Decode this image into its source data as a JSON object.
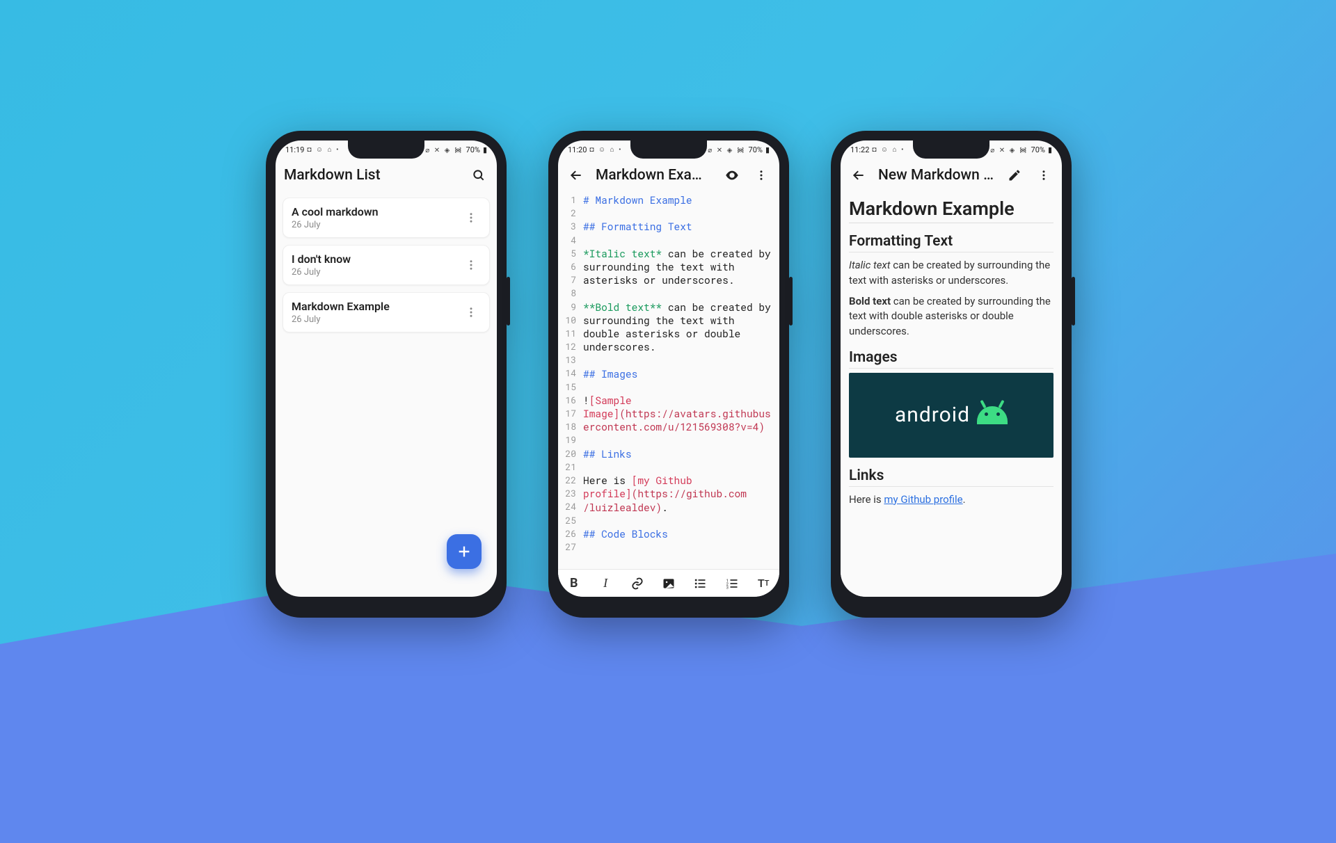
{
  "phone1": {
    "status": {
      "time": "11:19",
      "left_icons": "◘ ☺ ⌂ •",
      "right_icons": "⌀ ✕ ◈ ᯼",
      "battery": "70%"
    },
    "appbar": {
      "title": "Markdown List"
    },
    "notes": [
      {
        "name": "A cool markdown",
        "date": "26 July"
      },
      {
        "name": "I don't know",
        "date": "26 July"
      },
      {
        "name": "Markdown Example",
        "date": "26 July"
      }
    ]
  },
  "phone2": {
    "status": {
      "time": "11:20",
      "left_icons": "◘ ☺ ⌂ •",
      "right_icons": "⌀ ✕ ◈ ᯼",
      "battery": "70%"
    },
    "appbar": {
      "title": "Markdown Examp…"
    },
    "lines": [
      "1",
      "2",
      "3",
      "4",
      "5",
      "6",
      "7",
      "8",
      "9",
      "10",
      "11",
      "12",
      "13",
      "14",
      "15",
      "16",
      "17",
      "18",
      "19",
      "20",
      "21",
      "22",
      "23",
      "24",
      "25",
      "26",
      "27"
    ],
    "code": {
      "l1": "# Markdown Example",
      "l3": "## Formatting Text",
      "l5a": "*",
      "l5b": "Italic text",
      "l5c": "*",
      "l5d": " can be created by",
      "l6": "surrounding the text with",
      "l7": "asterisks or underscores.",
      "l9a": "**",
      "l9b": "Bold text",
      "l9c": "**",
      "l9d": " can be created by",
      "l10": "surrounding the text with",
      "l11": "double asterisks or double",
      "l12": "underscores.",
      "l14": "## Images",
      "l16a": "!",
      "l16b": "[Sample",
      "l17": "Image]",
      "l17b": "(https://avatars.githubus",
      "l18": "ercontent.com/u/121569308?v=4)",
      "l20": "## Links",
      "l22a": "Here is ",
      "l22b": "[my Github",
      "l23": "profile]",
      "l23b": "(https://github.com",
      "l24": "/luizlealdev)",
      "l24b": ".",
      "l26": "## Code Blocks"
    }
  },
  "phone3": {
    "status": {
      "time": "11:22",
      "left_icons": "◘ ☺ ⌂ •",
      "right_icons": "⌀ ✕ ◈ ᯼",
      "battery": "70%"
    },
    "appbar": {
      "title": "New Markdown N…"
    },
    "preview": {
      "h1": "Markdown Example",
      "h2a": "Formatting Text",
      "p1_em": "Italic text",
      "p1_rest": " can be created by surrounding the text with asterisks or underscores.",
      "p2_b": "Bold text",
      "p2_rest": " can be created by surrounding the text with double asterisks or double underscores.",
      "h2b": "Images",
      "android_label": "android",
      "h2c": "Links",
      "p3_pre": "Here is ",
      "p3_link": "my Github profile",
      "p3_post": "."
    }
  }
}
